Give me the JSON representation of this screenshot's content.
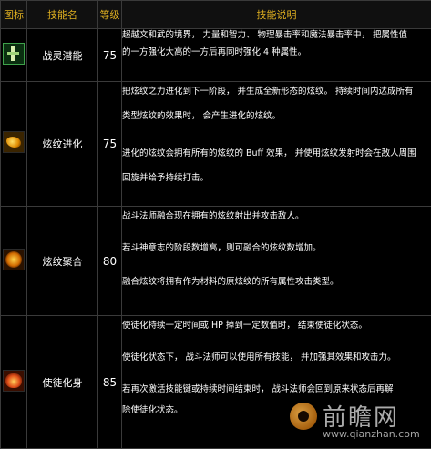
{
  "headers": {
    "icon": "图标",
    "name": "技能名",
    "level": "等级",
    "description": "技能说明"
  },
  "skills": [
    {
      "icon": "green-figure-icon",
      "name": "战灵潜能",
      "level": "75",
      "lines": [
        "超越文和武的境界， 力量和智力、 物理暴击率和魔法暴击率中， 把属性值",
        "的一方强化大高的一方后再同时强化 4 种属性。"
      ]
    },
    {
      "icon": "golden-emblem-icon",
      "name": "炫纹进化",
      "level": "75",
      "lines": [
        "把炫纹之力进化到下一阶段， 并生成全新形态的炫纹。 持续时间内达成所有",
        "类型炫纹的效果时， 会产生进化的炫纹。",
        "进化的炫纹会拥有所有的炫纹的 Buff 效果， 并使用炫纹发射时会在敌人周围",
        "回旋并给予持续打击。"
      ]
    },
    {
      "icon": "swirl-orb-icon",
      "name": "炫纹聚合",
      "level": "80",
      "lines": [
        "战斗法师融合现在拥有的炫纹射出并攻击敌人。",
        "若斗神意志的阶段数增高，则可融合的炫纹数增加。",
        "融合炫纹将拥有作为材料的原炫纹的所有属性攻击类型。"
      ]
    },
    {
      "icon": "flame-burst-icon",
      "name": "使徒化身",
      "level": "85",
      "lines": [
        "使徒化持续一定时间或 HP 掉到一定数值时， 结束使徒化状态。",
        "使徒化状态下， 战斗法师可以使用所有技能， 并加强其效果和攻击力。",
        "若再次激活技能键或持续时间结束时， 战斗法师会回到原来状态后再解",
        "除使徒化状态。"
      ]
    }
  ],
  "watermark": {
    "brand": "前瞻网",
    "url": "www.qianzhan.com",
    "logo": "qianzhan-logo-icon"
  }
}
